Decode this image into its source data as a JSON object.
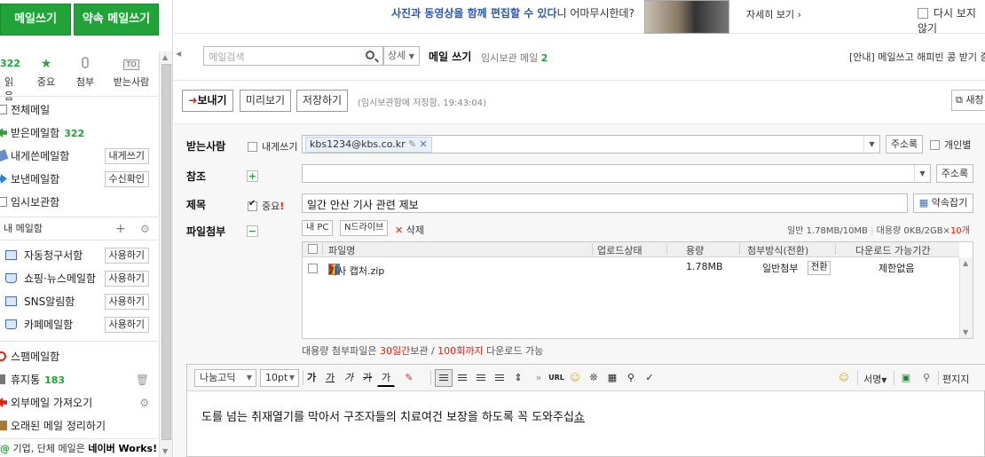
{
  "sidebar": {
    "write_button": "메일쓰기",
    "self_button": "약속 메일쓰기",
    "quick": {
      "unread_count": "322",
      "unread_label": "읽음",
      "starred_label": "중요",
      "attach_label": "첨부",
      "to_badge": "TO",
      "to_label": "받는사람"
    },
    "folders": {
      "all": "전체메일",
      "inbox": "받은메일함",
      "inbox_count": "322",
      "tome": "내게쓴메일함",
      "tome_btn": "내게쓰기",
      "sent": "보낸메일함",
      "sent_btn": "수신확인",
      "drafts": "임시보관함"
    },
    "mybox": "내 메일함",
    "subfolders": [
      {
        "label": "자동청구서함",
        "btn": "사용하기"
      },
      {
        "label": "쇼핑·뉴스메일함",
        "btn": "사용하기"
      },
      {
        "label": "SNS알림함",
        "btn": "사용하기"
      },
      {
        "label": "카페메일함",
        "btn": "사용하기"
      }
    ],
    "spam": "스팸메일함",
    "trash": "휴지통",
    "trash_count": "183",
    "external": "외부메일 가져오기",
    "cleanup": "오래된 메일 정리하기",
    "works": {
      "prefix": "기업, 단체 메일은 ",
      "brand": "네이버 Works!"
    }
  },
  "ad": {
    "text_hl": "사진과 동영상을 함께 편집할 수 있다",
    "text_rest": "니 어마무시한데?",
    "more": "자세히 보기 ›",
    "never": "다시 보지 않기"
  },
  "toolbar": {
    "search_placeholder": "메일검색",
    "detail": "상세",
    "title": "메일 쓰기",
    "draft_label": "임시보관 메일",
    "draft_count": "2",
    "notice": "[안내] 메일쓰고 해피빈 콩 받기 증정"
  },
  "actions": {
    "send": "보내기",
    "preview": "미리보기",
    "save": "저장하기",
    "saved_msg": "(임시보관함에 저장함, 19:43:04)",
    "new_window": "새창"
  },
  "fields": {
    "to_label": "받는사람",
    "tome_check": "내게쓰기",
    "to_chip": "kbs1234@kbs.co.kr",
    "addrbook": "주소록",
    "individual": "개인별",
    "cc_label": "참조",
    "subject_label": "제목",
    "important_check": "중요",
    "important_mark": "!",
    "subject_value": "일간 안산 기사 관련 제보",
    "appointment": "약속잡기",
    "attach_label": "파일첨부"
  },
  "attachments": {
    "mypc": "내 PC",
    "ndrive": "N드라이브",
    "delete": "삭제",
    "quota_normal": "일반 1.78MB/10MB",
    "quota_big": "대용량 0KB/2GB×",
    "quota_big_count": "10개",
    "columns": [
      "파일명",
      "업로드상태",
      "용량",
      "첨부방식(전환)",
      "다운로드 가능기간"
    ],
    "files": [
      {
        "name": "기사 캡처.zip",
        "size": "1.78MB",
        "method": "일반첨부",
        "convert": "전환",
        "period": "제한없음"
      }
    ],
    "bigfile_pre": "대용량 첨부파일은 ",
    "bigfile_days": "30일간",
    "bigfile_mid": "보관 / ",
    "bigfile_times": "100회까지",
    "bigfile_post": " 다운로드 가능"
  },
  "editor": {
    "font": "나눔고딕",
    "size": "10pt",
    "bold": "가",
    "underline": "가",
    "italic": "가",
    "strike": "가",
    "color": "가",
    "url": "URL",
    "signature": "서명",
    "stationery": "편지지",
    "body_text": "도를 넘는 취재열기를 막아서 구조자들의 치료여건 보장을 하도록 꼭 도와주십",
    "body_tail": "쇼"
  }
}
